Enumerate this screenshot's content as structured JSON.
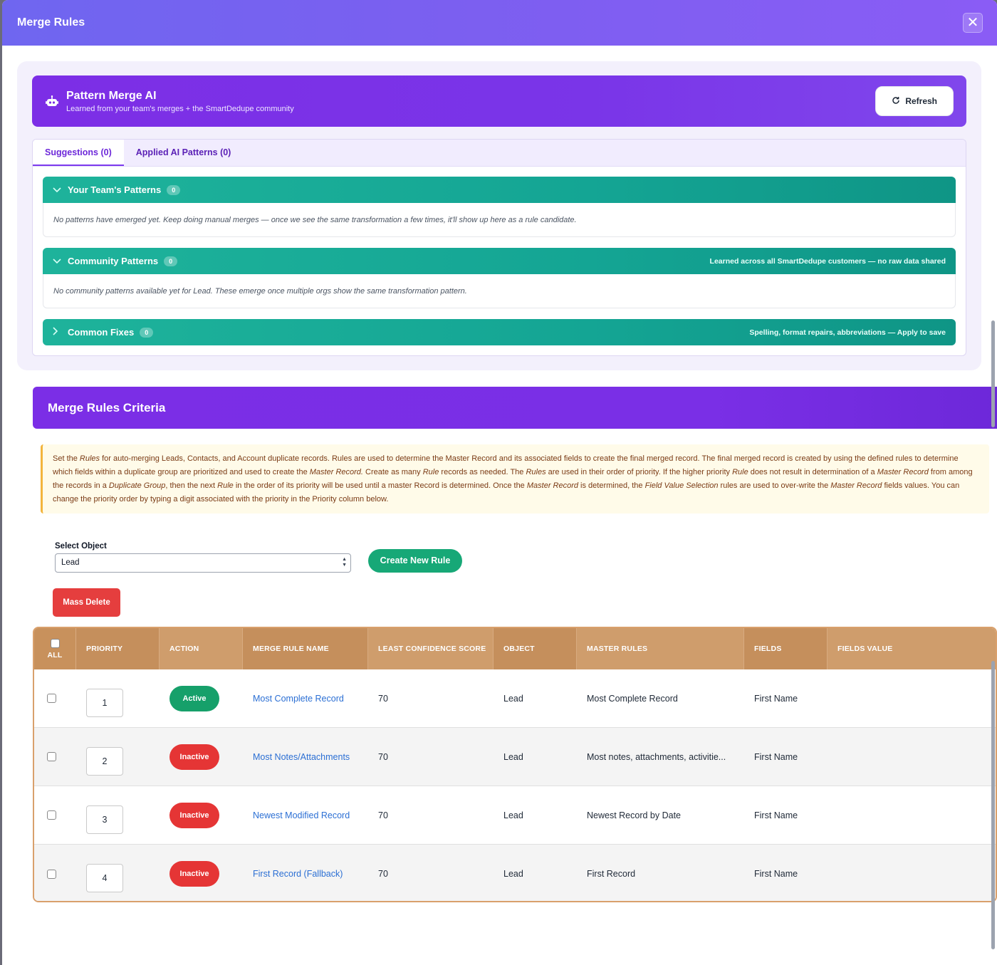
{
  "modal": {
    "title": "Merge Rules",
    "close_label": "✕"
  },
  "ai": {
    "title": "Pattern Merge AI",
    "subtitle": "Learned from your team's merges + the SmartDedupe community",
    "refresh_label": "Refresh",
    "tabs": [
      {
        "label": "Suggestions (0)"
      },
      {
        "label": "Applied AI Patterns (0)"
      }
    ],
    "sections": [
      {
        "title": "Your Team's Patterns",
        "count": "0",
        "note": "",
        "body": "No patterns have emerged yet. Keep doing manual merges — once we see the same transformation a few times, it'll show up here as a rule candidate."
      },
      {
        "title": "Community Patterns",
        "count": "0",
        "note": "Learned across all SmartDedupe customers — no raw data shared",
        "body": "No community patterns available yet for Lead. These emerge once multiple orgs show the same transformation pattern."
      },
      {
        "title": "Common Fixes",
        "count": "0",
        "note": "Spelling, format repairs, abbreviations — Apply to save",
        "body": ""
      }
    ]
  },
  "criteria": {
    "title": "Merge Rules Criteria",
    "info": {
      "p1": "Set the ",
      "e1": "Rules",
      "p2": " for auto-merging Leads, Contacts, and Account duplicate records. Rules are used to determine the Master Record and its associated fields to create the final merged record. The final merged record is created by using the defined rules to determine which fields within a duplicate group are prioritized and used to create the ",
      "e2": "Master Record.",
      "p3": " Create as many ",
      "e3": "Rule",
      "p4": " records as needed. The ",
      "e4": "Rules",
      "p5": " are used in their order of priority. If the higher priority ",
      "e5": "Rule",
      "p6": " does not result in determination of a ",
      "e6": "Master Record",
      "p7": " from among the records in a ",
      "e7": "Duplicate Group",
      "p8": ", then the next ",
      "e8": "Rule",
      "p9": " in the order of its priority will be used until a master Record is determined. Once the ",
      "e9": "Master Record",
      "p10": " is determined, the ",
      "e10": "Field Value Selection",
      "p11": " rules are used to over-write the ",
      "e11": "Master Record",
      "p12": " fields values. You can change the priority order by typing a digit associated with the priority in the Priority column below."
    },
    "select_label": "Select Object",
    "select_value": "Lead",
    "create_label": "Create New Rule",
    "mass_delete_label": "Mass Delete"
  },
  "table": {
    "headers": {
      "all": "ALL",
      "priority": "PRIORITY",
      "action": "ACTION",
      "name": "MERGE RULE NAME",
      "score": "LEAST CONFIDENCE SCORE",
      "object": "OBJECT",
      "master": "MASTER RULES",
      "fields": "FIELDS",
      "fields_value": "FIELDS VALUE"
    },
    "rows": [
      {
        "priority": "1",
        "status": "Active",
        "name": "Most Complete Record",
        "score": "70",
        "object": "Lead",
        "master": "Most Complete Record",
        "fields": "First Name",
        "fields_value": ""
      },
      {
        "priority": "2",
        "status": "Inactive",
        "name": "Most Notes/Attachments",
        "score": "70",
        "object": "Lead",
        "master": "Most notes, attachments, activitie...",
        "fields": "First Name",
        "fields_value": ""
      },
      {
        "priority": "3",
        "status": "Inactive",
        "name": "Newest Modified Record",
        "score": "70",
        "object": "Lead",
        "master": "Newest Record by Date",
        "fields": "First Name",
        "fields_value": ""
      },
      {
        "priority": "4",
        "status": "Inactive",
        "name": "First Record (Fallback)",
        "score": "70",
        "object": "Lead",
        "master": "First Record",
        "fields": "First Name",
        "fields_value": ""
      }
    ]
  },
  "colors": {
    "header_gradient": "#7b5ff0",
    "ai_banner": "#7c2ee6",
    "teal": "#14a594",
    "active": "#16a06a",
    "inactive": "#e53535",
    "table_header": "#cf9d6c",
    "link": "#2b6fd4"
  }
}
